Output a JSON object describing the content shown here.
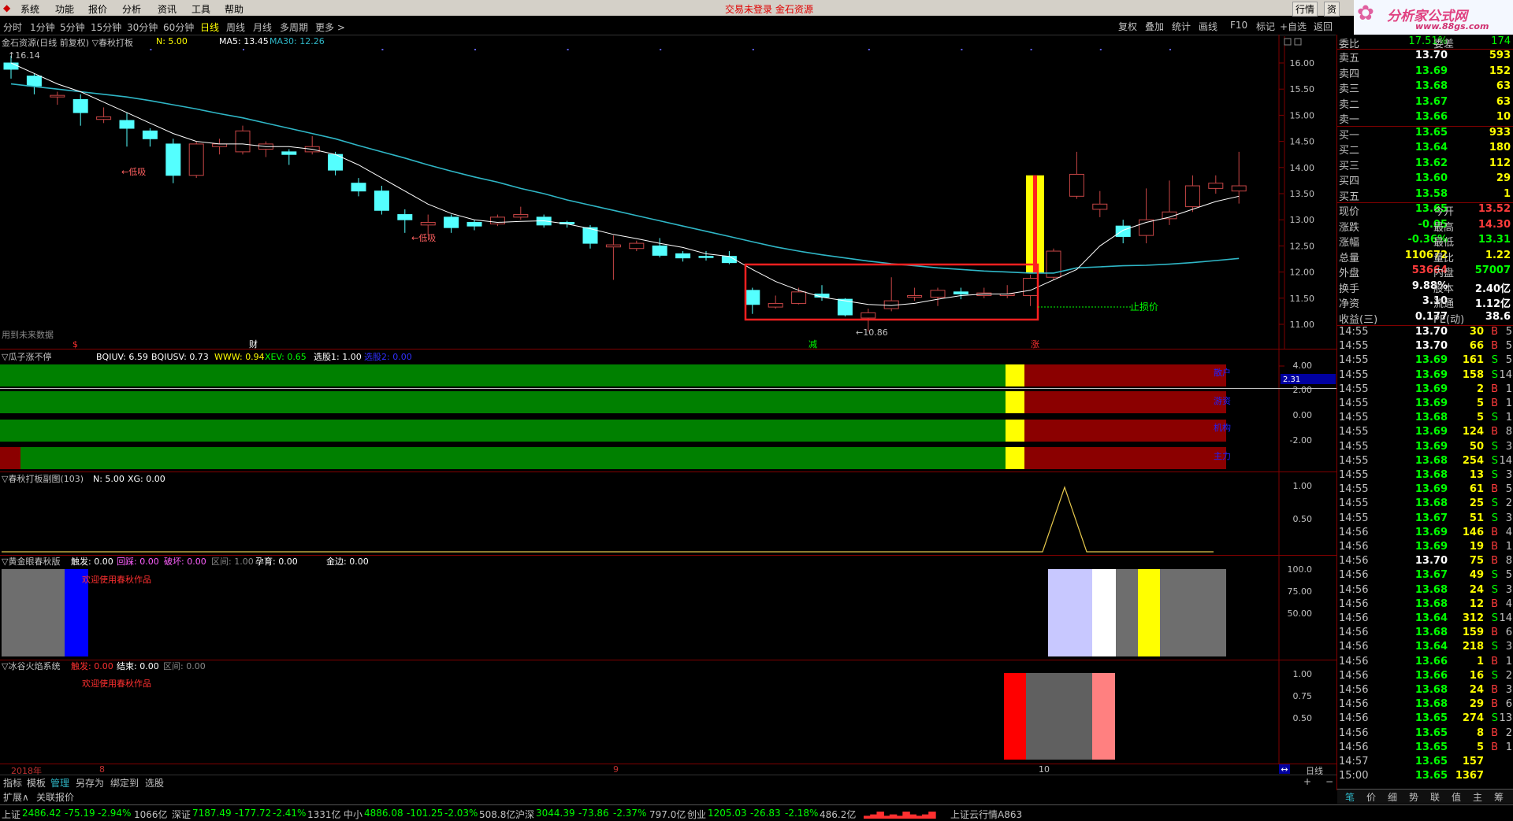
{
  "menu": {
    "items": [
      "系统",
      "功能",
      "报价",
      "分析",
      "资讯",
      "工具",
      "帮助"
    ],
    "center_text": "交易未登录  金石资源",
    "right_btns": [
      "行",
      "情",
      "资"
    ],
    "logo_text": "分析家公式网",
    "logo_url": "www.88gs.com"
  },
  "periods": [
    "分时",
    "1分钟",
    "5分钟",
    "15分钟",
    "30分钟",
    "60分钟",
    "日线",
    "周线",
    "月线",
    "多周期",
    "更多 >"
  ],
  "active_period": "日线",
  "tools": [
    "复权",
    "叠加",
    "统计",
    "画线",
    "F10",
    "标记",
    "+自选",
    "返回"
  ],
  "main": {
    "title": "金石资源(日线 前复权) ▽春秋打板",
    "n_label": "N: 5.00",
    "ma5": "MA5: 13.45",
    "ma30": "MA30: 12.26",
    "price_ticks": [
      "16.00",
      "15.50",
      "15.00",
      "14.50",
      "14.00",
      "13.50",
      "13.00",
      "12.50",
      "12.00",
      "11.50",
      "11.00"
    ],
    "high_label": "16.14",
    "low_label": "←10.86",
    "ann_dixi1": "←低吸",
    "ann_dixi2": "←低吸",
    "ann_zhisun": "止损价",
    "future_note": "用到未来数据",
    "markers": [
      "$",
      "财",
      "减",
      "涨"
    ],
    "cur_tag": "2.31"
  },
  "p1": {
    "title": "▽瓜子涨不停",
    "vals": [
      "BQIUV: 6.59",
      "BQIUSV: 0.73",
      "WWW: 0.94",
      "XEV: 0.65",
      "选股1: 1.00",
      "选股2: 0.00"
    ],
    "ticks": [
      "4.00",
      "2.00",
      "0.00",
      "-2.00"
    ],
    "row_labels": [
      "散户",
      "游资",
      "机构",
      "主力"
    ]
  },
  "p2": {
    "title": "▽春秋打板副图(103)",
    "vals": [
      "N: 5.00",
      "XG: 0.00"
    ],
    "ticks": [
      "1.00",
      "0.50"
    ]
  },
  "p3": {
    "title": "▽黄金眼春秋版",
    "vals": [
      "触发: 0.00",
      "回踩: 0.00",
      "破坏: 0.00",
      "区间: 1.00",
      "孕育: 0.00",
      "金边: 0.00"
    ],
    "ticks": [
      "100.0",
      "75.00",
      "50.00"
    ],
    "welcome": "欢迎使用春秋作品"
  },
  "p4": {
    "title": "▽冰谷火焰系统",
    "vals": [
      "触发: 0.00",
      "结束: 0.00",
      "区间: 0.00"
    ],
    "ticks": [
      "1.00",
      "0.75",
      "0.50"
    ],
    "welcome": "欢迎使用春秋作品"
  },
  "xaxis": {
    "year": "2018年",
    "m8": "8",
    "m9": "9",
    "m10": "10",
    "period": "日线"
  },
  "bottom_tabs": [
    "指标",
    "模板",
    "管理",
    "另存为",
    "绑定到",
    "选股"
  ],
  "bottom_tabs2": [
    "扩展∧",
    "关联报价"
  ],
  "quote": {
    "weibi": [
      "委比",
      "17.51%",
      "委差",
      "174"
    ],
    "sell": [
      [
        "卖五",
        "13.70",
        "593"
      ],
      [
        "卖四",
        "13.69",
        "152"
      ],
      [
        "卖三",
        "13.68",
        "63"
      ],
      [
        "卖二",
        "13.67",
        "63"
      ],
      [
        "卖一",
        "13.66",
        "10"
      ]
    ],
    "buy": [
      [
        "买一",
        "13.65",
        "933"
      ],
      [
        "买二",
        "13.64",
        "180"
      ],
      [
        "买三",
        "13.62",
        "112"
      ],
      [
        "买四",
        "13.60",
        "29"
      ],
      [
        "买五",
        "13.58",
        "1"
      ]
    ],
    "stats": [
      [
        "现价",
        "13.65",
        "今开",
        "13.52"
      ],
      [
        "涨跌",
        "-0.05",
        "最高",
        "14.30"
      ],
      [
        "涨幅",
        "-0.36%",
        "最低",
        "13.31"
      ],
      [
        "总量",
        "110672",
        "量比",
        "1.22"
      ],
      [
        "外盘",
        "53664",
        "内盘",
        "57007"
      ],
      [
        "换手",
        "9.88%",
        "股本",
        "2.40亿"
      ],
      [
        "净资",
        "3.10",
        "流通",
        "1.12亿"
      ],
      [
        "收益(三)",
        "0.177",
        "PE(动)",
        "38.6"
      ]
    ],
    "ticks": [
      [
        "14:55",
        "13.70",
        "30",
        "B",
        "5"
      ],
      [
        "14:55",
        "13.70",
        "66",
        "B",
        "5"
      ],
      [
        "14:55",
        "13.69",
        "161",
        "S",
        "5"
      ],
      [
        "14:55",
        "13.69",
        "158",
        "S",
        "14"
      ],
      [
        "14:55",
        "13.69",
        "2",
        "B",
        "1"
      ],
      [
        "14:55",
        "13.69",
        "5",
        "B",
        "1"
      ],
      [
        "14:55",
        "13.68",
        "5",
        "S",
        "1"
      ],
      [
        "14:55",
        "13.69",
        "124",
        "B",
        "8"
      ],
      [
        "14:55",
        "13.69",
        "50",
        "S",
        "3"
      ],
      [
        "14:55",
        "13.68",
        "254",
        "S",
        "14"
      ],
      [
        "14:55",
        "13.68",
        "13",
        "S",
        "3"
      ],
      [
        "14:55",
        "13.69",
        "61",
        "B",
        "5"
      ],
      [
        "14:55",
        "13.68",
        "25",
        "S",
        "2"
      ],
      [
        "14:55",
        "13.67",
        "51",
        "S",
        "3"
      ],
      [
        "14:56",
        "13.69",
        "146",
        "B",
        "4"
      ],
      [
        "14:56",
        "13.69",
        "19",
        "B",
        "1"
      ],
      [
        "14:56",
        "13.70",
        "75",
        "B",
        "8"
      ],
      [
        "14:56",
        "13.67",
        "49",
        "S",
        "5"
      ],
      [
        "14:56",
        "13.68",
        "24",
        "S",
        "3"
      ],
      [
        "14:56",
        "13.68",
        "12",
        "B",
        "4"
      ],
      [
        "14:56",
        "13.64",
        "312",
        "S",
        "14"
      ],
      [
        "14:56",
        "13.68",
        "159",
        "B",
        "6"
      ],
      [
        "14:56",
        "13.64",
        "218",
        "S",
        "3"
      ],
      [
        "14:56",
        "13.66",
        "1",
        "B",
        "1"
      ],
      [
        "14:56",
        "13.66",
        "16",
        "S",
        "2"
      ],
      [
        "14:56",
        "13.68",
        "24",
        "B",
        "3"
      ],
      [
        "14:56",
        "13.68",
        "29",
        "B",
        "6"
      ],
      [
        "14:56",
        "13.65",
        "274",
        "S",
        "13"
      ],
      [
        "14:56",
        "13.65",
        "8",
        "B",
        "2"
      ],
      [
        "14:56",
        "13.65",
        "5",
        "B",
        "1"
      ],
      [
        "14:57",
        "13.65",
        "157",
        "",
        ""
      ],
      [
        "15:00",
        "13.65",
        "1367",
        "",
        ""
      ]
    ],
    "bottom_tabs": [
      "笔",
      "价",
      "细",
      "势",
      "联",
      "值",
      "主",
      "筹"
    ]
  },
  "status": {
    "sh": [
      "上证",
      "2486.42",
      "-75.19",
      "-2.94%",
      "1066亿"
    ],
    "sz": [
      "深证",
      "7187.49",
      "-177.72",
      "-2.41%",
      "1331亿"
    ],
    "zx": [
      "中小",
      "4886.08",
      "-101.25",
      "-2.03%",
      "508.8亿"
    ],
    "hs": [
      "沪深",
      "3044.39",
      "-73.86",
      "-2.37%",
      "797.0亿"
    ],
    "cy": [
      "创业",
      "1205.03",
      "-26.83",
      "-2.18%",
      "486.2亿"
    ],
    "cloud": "上证云行情A863"
  },
  "colors": {
    "up": "#ff3c3c",
    "down": "#54ffff",
    "ma30": "#2fb6c6",
    "ma5": "#ffffff",
    "yellow": "#ffff00",
    "green": "#008000",
    "darkred": "#8b0000"
  },
  "chart_data": {
    "type": "candlestick",
    "candles": [
      {
        "o": 16.0,
        "c": 15.88,
        "h": 16.14,
        "l": 15.7
      },
      {
        "o": 15.75,
        "c": 15.56,
        "h": 15.8,
        "l": 15.4
      },
      {
        "o": 15.35,
        "c": 15.38,
        "h": 15.45,
        "l": 15.2
      },
      {
        "o": 15.3,
        "c": 15.05,
        "h": 15.4,
        "l": 14.8
      },
      {
        "o": 14.92,
        "c": 14.97,
        "h": 15.15,
        "l": 14.85
      },
      {
        "o": 14.9,
        "c": 14.75,
        "h": 15.05,
        "l": 14.4
      },
      {
        "o": 14.7,
        "c": 14.55,
        "h": 14.75,
        "l": 14.4
      },
      {
        "o": 14.45,
        "c": 13.85,
        "h": 14.55,
        "l": 13.7
      },
      {
        "o": 13.85,
        "c": 14.45,
        "h": 14.5,
        "l": 13.8
      },
      {
        "o": 14.4,
        "c": 14.45,
        "h": 14.55,
        "l": 14.25
      },
      {
        "o": 14.3,
        "c": 14.7,
        "h": 14.8,
        "l": 14.25
      },
      {
        "o": 14.35,
        "c": 14.45,
        "h": 14.5,
        "l": 14.2
      },
      {
        "o": 14.3,
        "c": 14.25,
        "h": 14.35,
        "l": 14.05
      },
      {
        "o": 14.3,
        "c": 14.4,
        "h": 14.6,
        "l": 14.25
      },
      {
        "o": 14.25,
        "c": 13.95,
        "h": 14.3,
        "l": 13.85
      },
      {
        "o": 13.7,
        "c": 13.55,
        "h": 13.8,
        "l": 13.45
      },
      {
        "o": 13.55,
        "c": 13.18,
        "h": 13.65,
        "l": 13.1
      },
      {
        "o": 13.1,
        "c": 13.0,
        "h": 13.2,
        "l": 12.75
      },
      {
        "o": 12.9,
        "c": 12.95,
        "h": 13.1,
        "l": 12.7
      },
      {
        "o": 13.05,
        "c": 12.85,
        "h": 13.1,
        "l": 12.75
      },
      {
        "o": 12.95,
        "c": 12.88,
        "h": 13.0,
        "l": 12.8
      },
      {
        "o": 12.92,
        "c": 13.05,
        "h": 13.1,
        "l": 12.88
      },
      {
        "o": 13.05,
        "c": 13.1,
        "h": 13.25,
        "l": 13.0
      },
      {
        "o": 13.05,
        "c": 12.9,
        "h": 13.1,
        "l": 12.85
      },
      {
        "o": 12.95,
        "c": 12.92,
        "h": 12.98,
        "l": 12.85
      },
      {
        "o": 12.85,
        "c": 12.55,
        "h": 12.9,
        "l": 12.45
      },
      {
        "o": 12.48,
        "c": 12.52,
        "h": 12.7,
        "l": 11.85
      },
      {
        "o": 12.45,
        "c": 12.55,
        "h": 12.6,
        "l": 12.4
      },
      {
        "o": 12.5,
        "c": 12.32,
        "h": 12.65,
        "l": 12.28
      },
      {
        "o": 12.35,
        "c": 12.27,
        "h": 12.4,
        "l": 12.2
      },
      {
        "o": 12.3,
        "c": 12.28,
        "h": 12.4,
        "l": 12.22
      },
      {
        "o": 12.3,
        "c": 12.18,
        "h": 12.4,
        "l": 12.15
      },
      {
        "o": 11.65,
        "c": 11.38,
        "h": 11.7,
        "l": 11.2
      },
      {
        "o": 11.33,
        "c": 11.4,
        "h": 11.55,
        "l": 11.3
      },
      {
        "o": 11.4,
        "c": 11.62,
        "h": 11.7,
        "l": 11.38
      },
      {
        "o": 11.58,
        "c": 11.52,
        "h": 11.75,
        "l": 11.45
      },
      {
        "o": 11.48,
        "c": 11.18,
        "h": 11.5,
        "l": 11.15
      },
      {
        "o": 11.12,
        "c": 11.22,
        "h": 11.3,
        "l": 10.86
      },
      {
        "o": 11.3,
        "c": 11.45,
        "h": 11.9,
        "l": 11.25
      },
      {
        "o": 11.52,
        "c": 11.55,
        "h": 11.7,
        "l": 11.45
      },
      {
        "o": 11.52,
        "c": 11.65,
        "h": 11.7,
        "l": 11.35
      },
      {
        "o": 11.62,
        "c": 11.58,
        "h": 11.7,
        "l": 11.48
      },
      {
        "o": 11.55,
        "c": 11.6,
        "h": 11.7,
        "l": 11.5
      },
      {
        "o": 11.55,
        "c": 11.58,
        "h": 11.75,
        "l": 11.5
      },
      {
        "o": 11.55,
        "c": 11.88,
        "h": 11.95,
        "l": 11.35
      },
      {
        "o": 11.9,
        "c": 12.4,
        "h": 12.45,
        "l": 11.85
      },
      {
        "o": 13.45,
        "c": 13.87,
        "h": 14.3,
        "l": 13.4
      },
      {
        "o": 13.2,
        "c": 13.3,
        "h": 13.55,
        "l": 13.05
      },
      {
        "o": 12.88,
        "c": 12.68,
        "h": 13.0,
        "l": 12.55
      },
      {
        "o": 12.7,
        "c": 13.0,
        "h": 13.6,
        "l": 12.55
      },
      {
        "o": 13.02,
        "c": 13.15,
        "h": 13.75,
        "l": 12.9
      },
      {
        "o": 13.25,
        "c": 13.65,
        "h": 13.85,
        "l": 13.15
      },
      {
        "o": 13.6,
        "c": 13.7,
        "h": 13.85,
        "l": 13.5
      },
      {
        "o": 13.55,
        "c": 13.65,
        "h": 14.3,
        "l": 13.31
      }
    ],
    "ma5": [
      16.0,
      15.8,
      15.6,
      15.45,
      15.25,
      15.05,
      14.85,
      14.65,
      14.5,
      14.45,
      14.45,
      14.4,
      14.4,
      14.35,
      14.25,
      14.05,
      13.8,
      13.55,
      13.3,
      13.12,
      13.0,
      12.95,
      12.97,
      12.98,
      12.92,
      12.83,
      12.72,
      12.64,
      12.55,
      12.47,
      12.35,
      12.3,
      12.05,
      11.82,
      11.65,
      11.52,
      11.45,
      11.38,
      11.36,
      11.4,
      11.48,
      11.55,
      11.58,
      11.58,
      11.65,
      11.85,
      12.05,
      12.5,
      12.8,
      12.95,
      13.05,
      13.2,
      13.35,
      13.45
    ],
    "ma30": [
      15.6,
      15.55,
      15.5,
      15.45,
      15.4,
      15.35,
      15.28,
      15.2,
      15.12,
      15.03,
      14.95,
      14.85,
      14.75,
      14.65,
      14.55,
      14.42,
      14.3,
      14.18,
      14.05,
      13.93,
      13.82,
      13.72,
      13.6,
      13.5,
      13.38,
      13.28,
      13.18,
      13.08,
      12.98,
      12.88,
      12.78,
      12.68,
      12.58,
      12.48,
      12.4,
      12.33,
      12.27,
      12.21,
      12.16,
      12.12,
      12.08,
      12.05,
      12.02,
      12.0,
      11.98,
      11.98,
      12.08,
      12.1,
      12.12,
      12.13,
      12.15,
      12.18,
      12.22,
      12.26
    ],
    "ylim": [
      10.8,
      16.2
    ],
    "p2_signal_index": 45
  }
}
